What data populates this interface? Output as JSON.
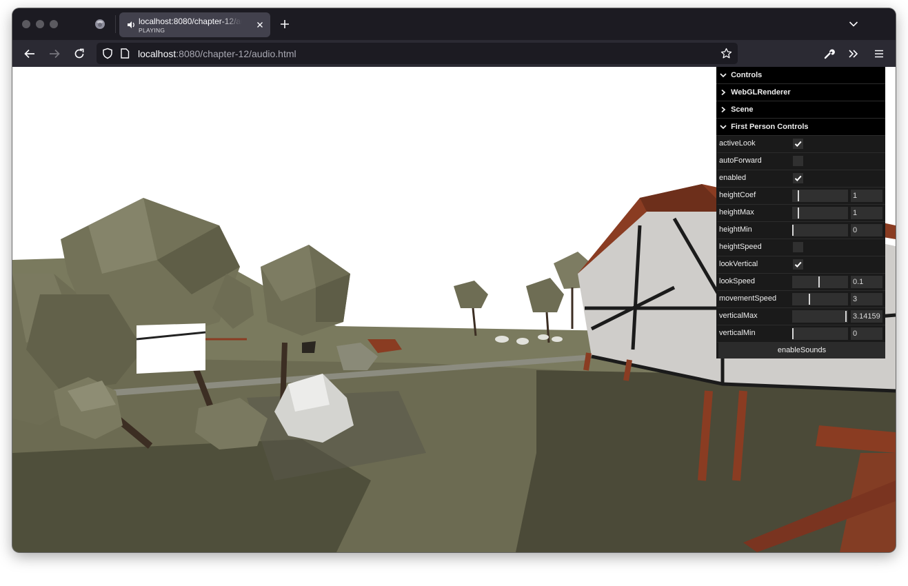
{
  "browser": {
    "tab": {
      "title": "localhost:8080/chapter-12/audio.html",
      "status": "PLAYING"
    },
    "url": {
      "host": "localhost",
      "rest": ":8080/chapter-12/audio.html"
    }
  },
  "gui": {
    "folders": {
      "controls": "Controls",
      "renderer": "WebGLRenderer",
      "scene": "Scene",
      "fpc": "First Person Controls"
    },
    "rows": [
      {
        "label": "activeLook",
        "type": "checkbox",
        "checked": true
      },
      {
        "label": "autoForward",
        "type": "checkbox",
        "checked": false
      },
      {
        "label": "enabled",
        "type": "checkbox",
        "checked": true
      },
      {
        "label": "heightCoef",
        "type": "slider",
        "value": "1",
        "level": 0.1
      },
      {
        "label": "heightMax",
        "type": "slider",
        "value": "1",
        "level": 0.1
      },
      {
        "label": "heightMin",
        "type": "slider",
        "value": "0",
        "level": 0.0
      },
      {
        "label": "heightSpeed",
        "type": "checkbox",
        "checked": false
      },
      {
        "label": "lookVertical",
        "type": "checkbox",
        "checked": true
      },
      {
        "label": "lookSpeed",
        "type": "slider",
        "value": "0.1",
        "level": 0.48
      },
      {
        "label": "movementSpeed",
        "type": "slider",
        "value": "3",
        "level": 0.3
      },
      {
        "label": "verticalMax",
        "type": "slider",
        "value": "3.14159",
        "level": 0.98
      },
      {
        "label": "verticalMin",
        "type": "slider",
        "value": "0",
        "level": 0.0
      }
    ],
    "button": "enableSounds"
  },
  "colors": {
    "gui_bg": "#1a1a1a",
    "gui_field": "#303030",
    "ground": "#6c6b52",
    "tree": "#6e6d54",
    "roof": "#8a3c22"
  }
}
